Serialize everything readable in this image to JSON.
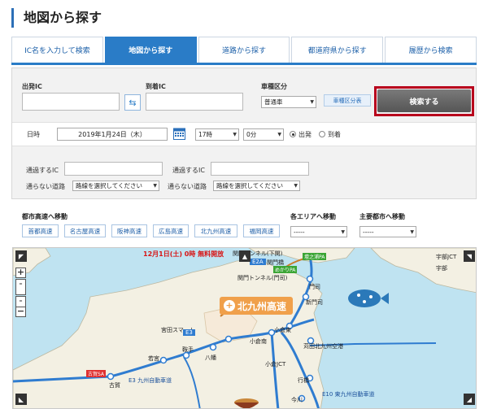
{
  "title": "地図から探す",
  "tabs": [
    {
      "label": "IC名を入力して検索"
    },
    {
      "label": "地図から探す"
    },
    {
      "label": "道路から探す"
    },
    {
      "label": "都道府県から探す"
    },
    {
      "label": "履歴から検索"
    }
  ],
  "form": {
    "departure_label": "出発IC",
    "arrival_label": "到着IC",
    "vehicle_label": "車種区分",
    "vehicle_value": "普通車",
    "vehicle_table_label": "車種区分表",
    "search_label": "検索する",
    "date_label": "日時",
    "date_value": "2019年1月24日（木）",
    "hour_value": "17時",
    "minute_value": "0分",
    "radio_depart": "出発",
    "radio_arrive": "到着",
    "via1_label": "通過するIC",
    "via2_label": "通過するIC",
    "avoid1_label": "通らない道路",
    "avoid2_label": "通らない道路",
    "avoid_placeholder": "路線を選択してください"
  },
  "nav": {
    "city_label": "都市高速へ移動",
    "area_label": "各エリアへ移動",
    "major_label": "主要都市へ移動",
    "area_value": "-----",
    "major_value": "-----",
    "cities": [
      "首都高速",
      "名古屋高速",
      "阪神高速",
      "広島高速",
      "北九州高速",
      "福岡高速"
    ]
  },
  "map": {
    "notice_line1": "12月1日(土) 0時 無料開放",
    "badge": "北九州高速",
    "labels": {
      "kanmon_tunnel": "関門トンネル(下関)",
      "kanmon_bridge": "関門橋",
      "mekari_pa": "めかりPA",
      "dannoura_pa": "壇之浦PA",
      "kanmon_moji": "関門トンネル(門司)",
      "moji": "門司",
      "shinmoji": "新門司",
      "kokuraminami": "小倉東",
      "kanda": "苅田北九州空港",
      "kokura_jct": "小倉JCT",
      "kokura_south": "小倉南",
      "miyata": "宮田スマート",
      "wakamiya": "若宮",
      "yahata": "八幡",
      "koga": "古賀",
      "koga_sa": "古賀SA",
      "yukuhashi": "行橋",
      "imagawa": "今川",
      "ujiiko": "宇部",
      "ube": "宇部JCT",
      "kurate": "鞍手",
      "road_e3": "E3 九州自動車道",
      "road_e10": "E10 東九州自動車道",
      "route_e2a": "E2A",
      "route_e3": "E3"
    }
  },
  "colors": {
    "accent": "#2a7cc7",
    "highlight": "#b8001c",
    "highway": "#2f7cd0",
    "badge": "#f0a04b"
  }
}
